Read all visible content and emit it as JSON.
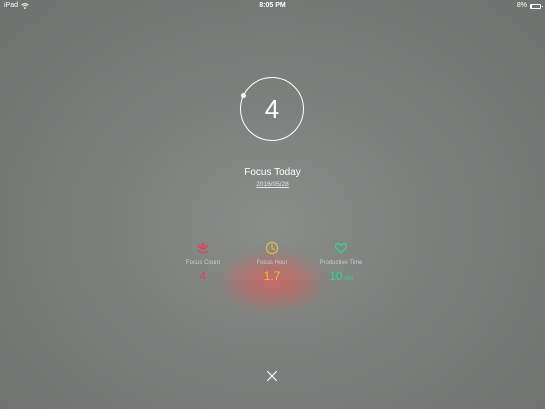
{
  "status_bar": {
    "device": "iPad",
    "wifi_icon": "wifi-icon",
    "time": "8:05 PM",
    "battery_percent": "8%",
    "battery_level": 0.08
  },
  "focus": {
    "count": "4",
    "title": "Focus Today",
    "date": "2016/05/28"
  },
  "stats": {
    "focus_count": {
      "icon": "lotus-icon",
      "label": "Focus Count",
      "value": "4",
      "color": "#e0405f"
    },
    "focus_hour": {
      "icon": "clock-icon",
      "label": "Focus Hour",
      "value": "1.7",
      "color": "#e8c23a"
    },
    "productive_time": {
      "icon": "heart-icon",
      "label": "Productive Time",
      "value": "10",
      "unit": "AM",
      "color": "#2ed69a"
    }
  },
  "close": {
    "icon": "close-icon"
  }
}
